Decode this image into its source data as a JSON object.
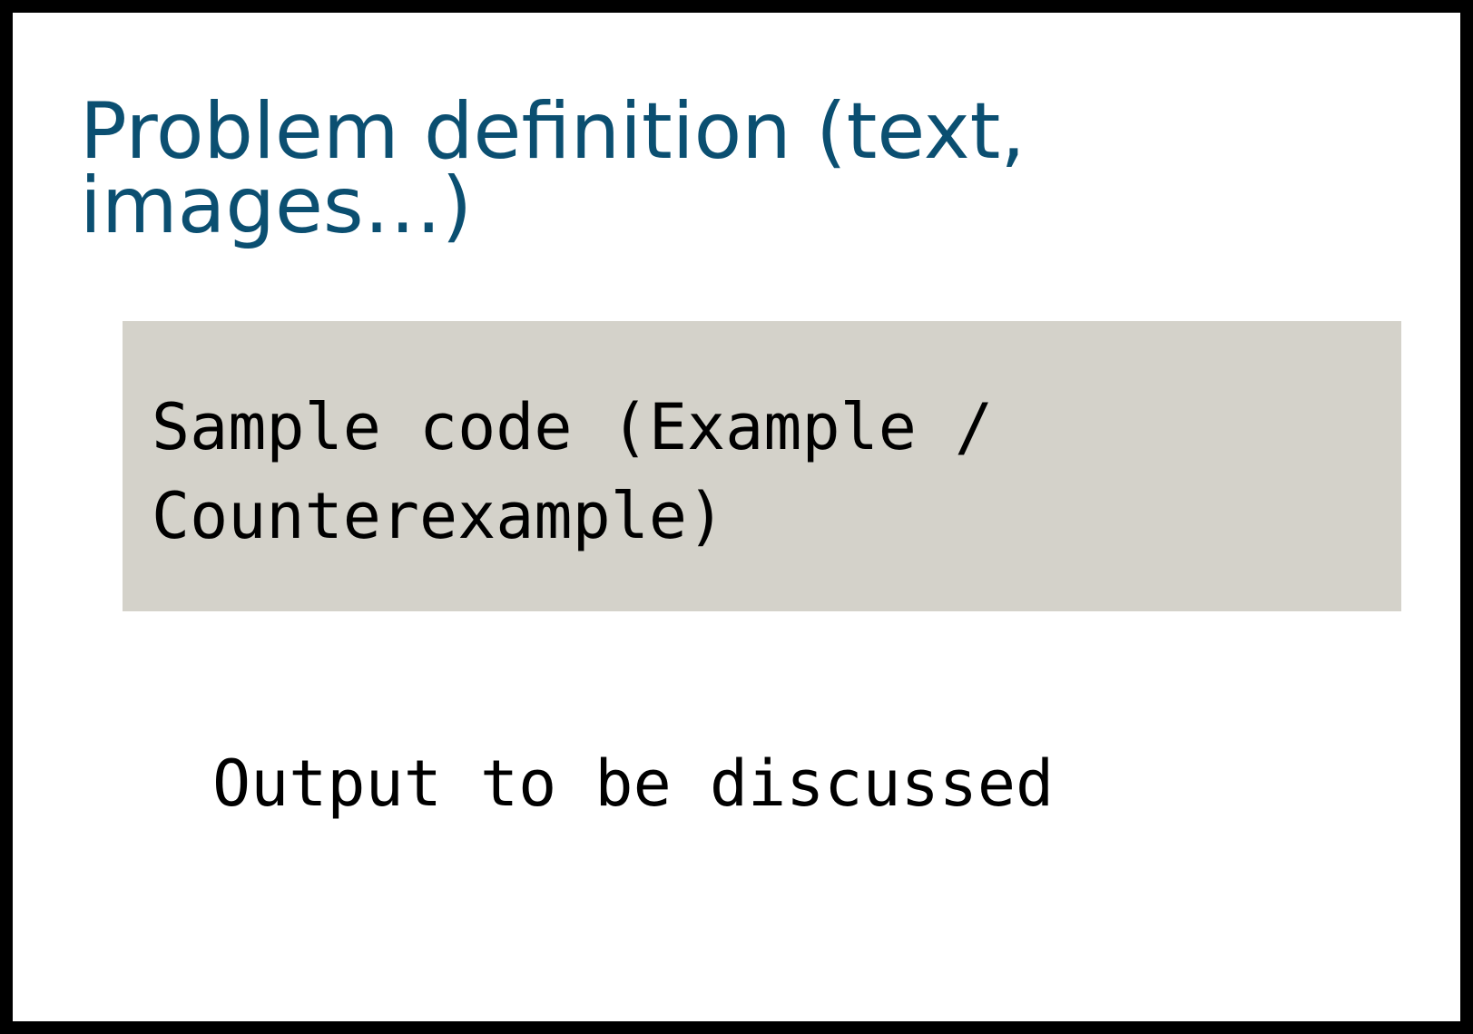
{
  "slide": {
    "title": "Problem definition (text, images…)",
    "code_block": "Sample code (Example / Counterexample)",
    "output": "Output to be discussed"
  },
  "colors": {
    "title": "#0b4f71",
    "code_background": "#d4d2ca",
    "border": "#000000"
  }
}
